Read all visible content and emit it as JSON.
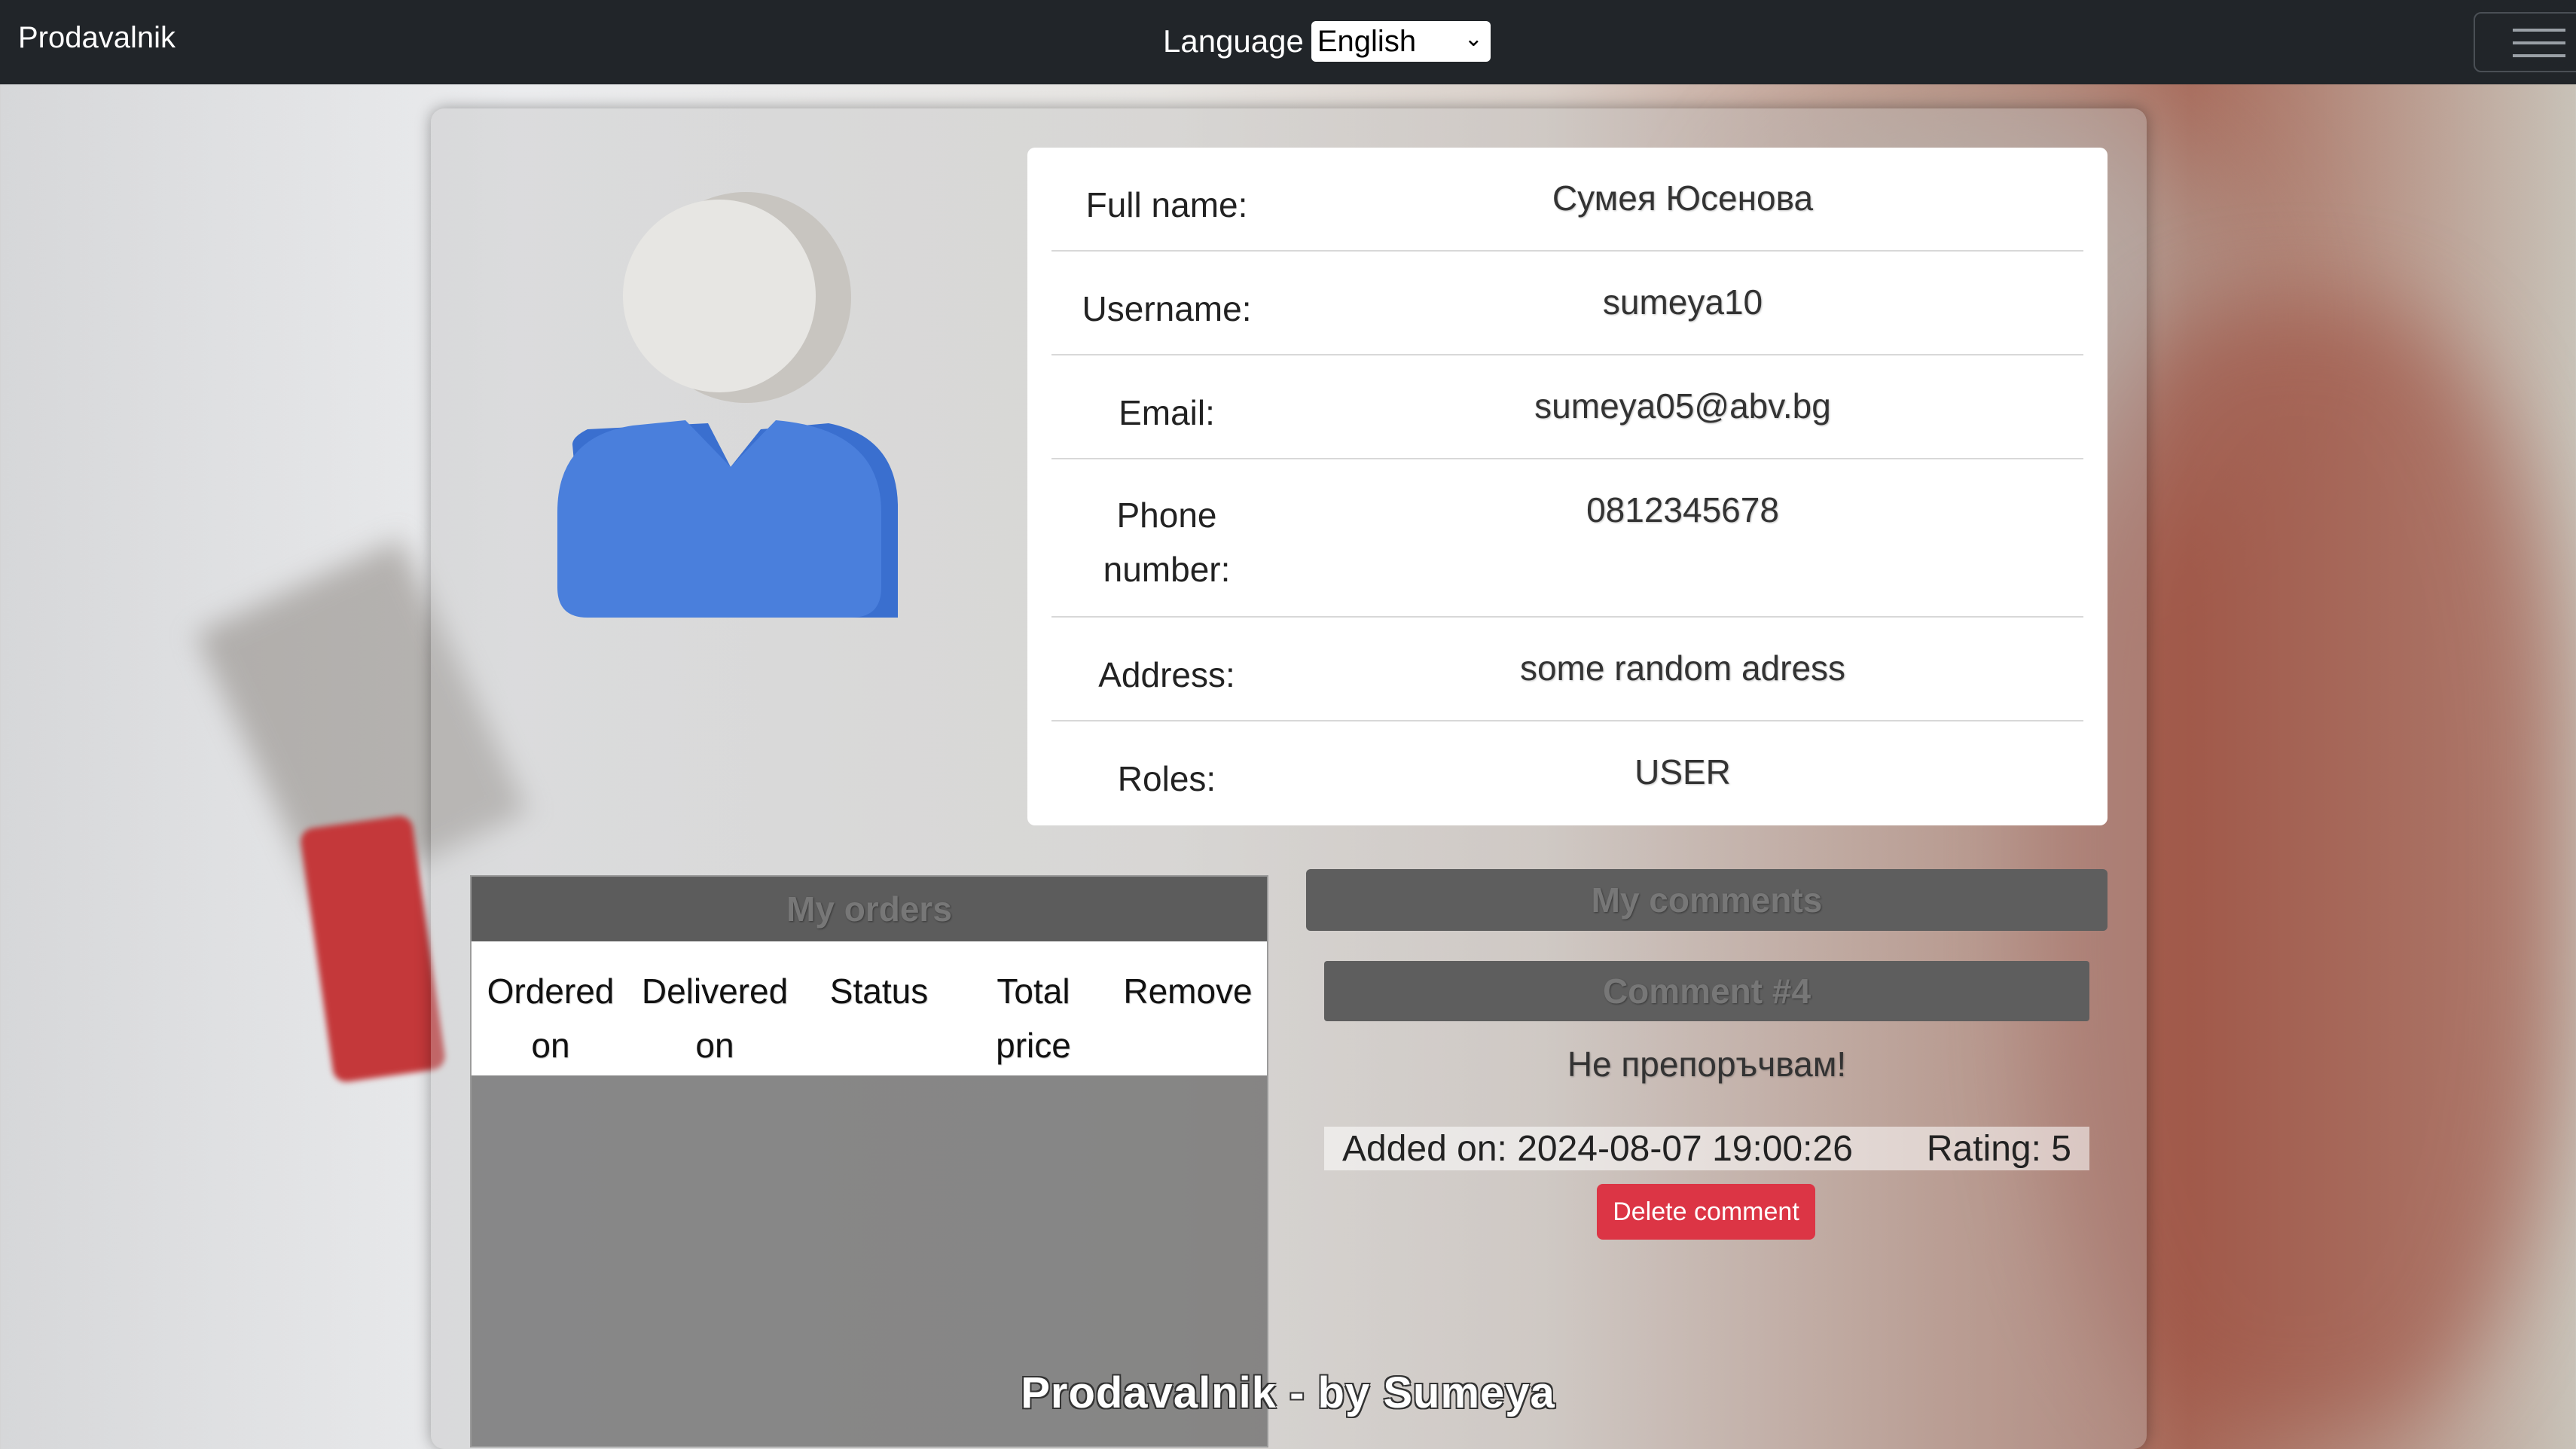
{
  "navbar": {
    "brand": "Prodavalnik",
    "language_label": "Language",
    "language_selected": "English",
    "menu_icon": "hamburger-menu-icon"
  },
  "profile": {
    "rows": [
      {
        "label": "Full name:",
        "value": "Сумея Юсенова"
      },
      {
        "label": "Username:",
        "value": "sumeya10"
      },
      {
        "label": "Email:",
        "value": "sumeya05@abv.bg"
      },
      {
        "label": "Phone number:",
        "value": "0812345678"
      },
      {
        "label": "Address:",
        "value": "some random adress"
      },
      {
        "label": "Roles:",
        "value": "USER"
      }
    ],
    "avatar_icon": "user-avatar-icon"
  },
  "orders": {
    "title": "My orders",
    "columns": [
      "Ordered on",
      "Delivered on",
      "Status",
      "Total price",
      "Remove"
    ]
  },
  "comments": {
    "title": "My comments",
    "items": [
      {
        "title": "Comment #4",
        "text": "Не препоръчвам!",
        "added_on": "Added on: 2024-08-07 19:00:26",
        "rating": "Rating: 5",
        "delete_label": "Delete comment"
      }
    ]
  },
  "footer": {
    "text": "Prodavalnik - by Sumeya"
  },
  "colors": {
    "navbar": "#212529",
    "danger": "#dc3545",
    "avatar_body": "#4a7fdc"
  }
}
